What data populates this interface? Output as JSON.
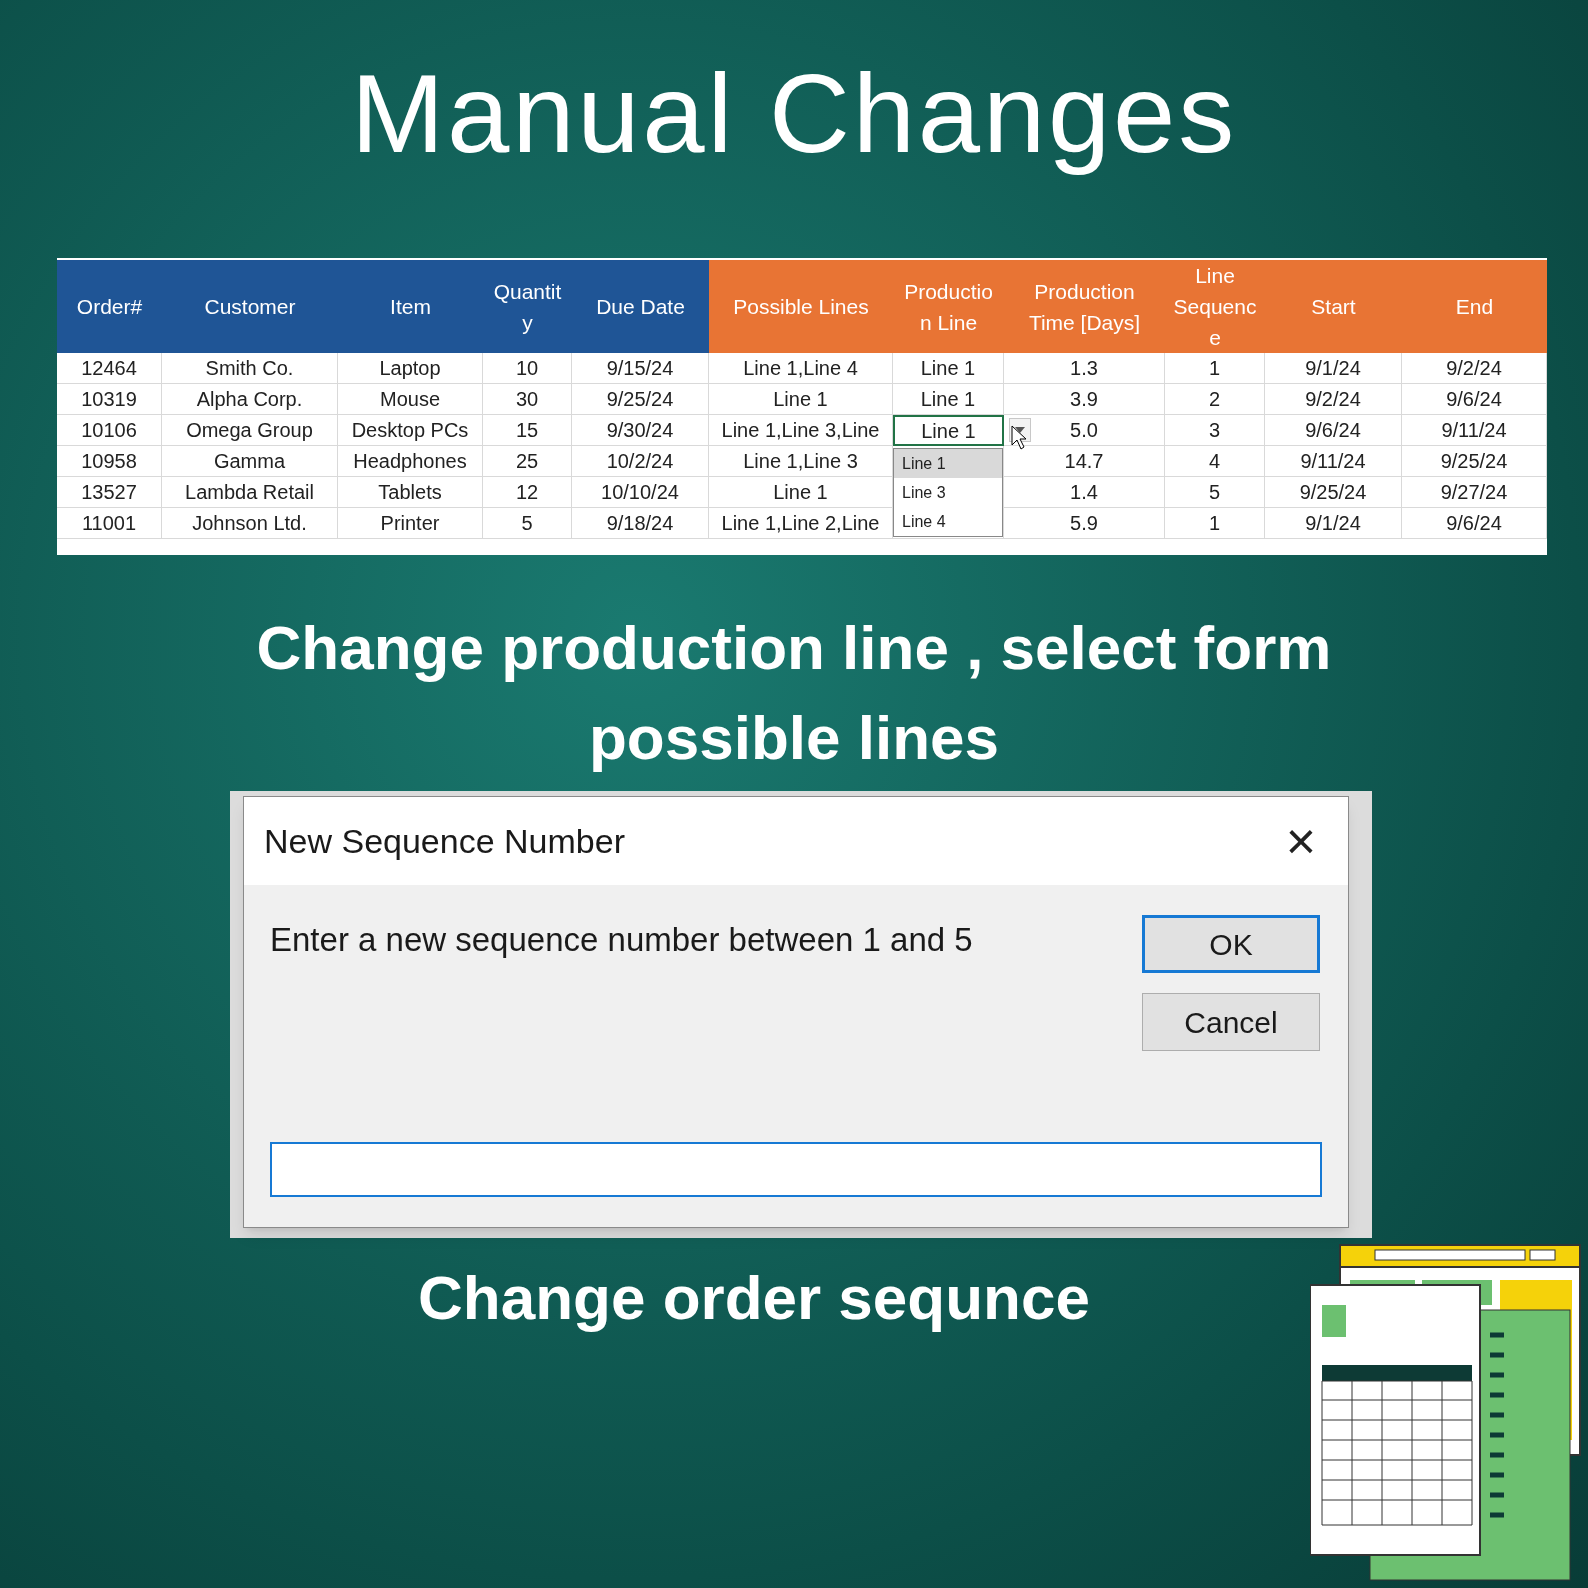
{
  "title": "Manual Changes",
  "table": {
    "columns": [
      "Order#",
      "Customer",
      "Item",
      "Quantit y",
      "Due Date",
      "Possible Lines",
      "Productio n Line",
      "Production Time [Days]",
      "Line Sequenc e",
      "Start",
      "End"
    ],
    "rows": [
      {
        "cells": [
          "12464",
          "Smith Co.",
          "Laptop",
          "10",
          "9/15/24",
          "Line 1,Line 4",
          "Line 1",
          "1.3",
          "1",
          "9/1/24",
          "9/2/24"
        ],
        "selected": false
      },
      {
        "cells": [
          "10319",
          "Alpha Corp.",
          "Mouse",
          "30",
          "9/25/24",
          "Line 1",
          "Line 1",
          "3.9",
          "2",
          "9/2/24",
          "9/6/24"
        ],
        "selected": false
      },
      {
        "cells": [
          "10106",
          "Omega Group",
          "Desktop PCs",
          "15",
          "9/30/24",
          "Line 1,Line 3,Line",
          "Line 1",
          "5.0",
          "3",
          "9/6/24",
          "9/11/24"
        ],
        "selected": true
      },
      {
        "cells": [
          "10958",
          "Gamma",
          "Headphones",
          "25",
          "10/2/24",
          "Line 1,Line 3",
          "14.7",
          "4",
          "9/11/24",
          "9/25/24"
        ],
        "selected": false
      },
      {
        "cells": [
          "13527",
          "Lambda Retail",
          "Tablets",
          "12",
          "10/10/24",
          "Line 1",
          "1.4",
          "5",
          "9/25/24",
          "9/27/24"
        ],
        "selected": false
      },
      {
        "cells": [
          "11001",
          "Johnson Ltd.",
          "Printer",
          "5",
          "9/18/24",
          "Line 1,Line 2,Line",
          "5.9",
          "1",
          "9/1/24",
          "9/6/24"
        ],
        "selected": false
      }
    ],
    "dropdown": [
      {
        "label": "Line 1",
        "selected": true
      },
      {
        "label": "Line 3",
        "selected": false
      },
      {
        "label": "Line 4",
        "selected": false
      }
    ]
  },
  "caption_1": "Change production line , select form possible lines",
  "dialog": {
    "title": "New Sequence Number",
    "close": "×",
    "message": "Enter a new sequence number between 1 and 5",
    "buttons": [
      {
        "label": "OK",
        "default": true
      },
      {
        "label": "Cancel",
        "default": false
      }
    ]
  },
  "caption_2": "Change order sequnce"
}
